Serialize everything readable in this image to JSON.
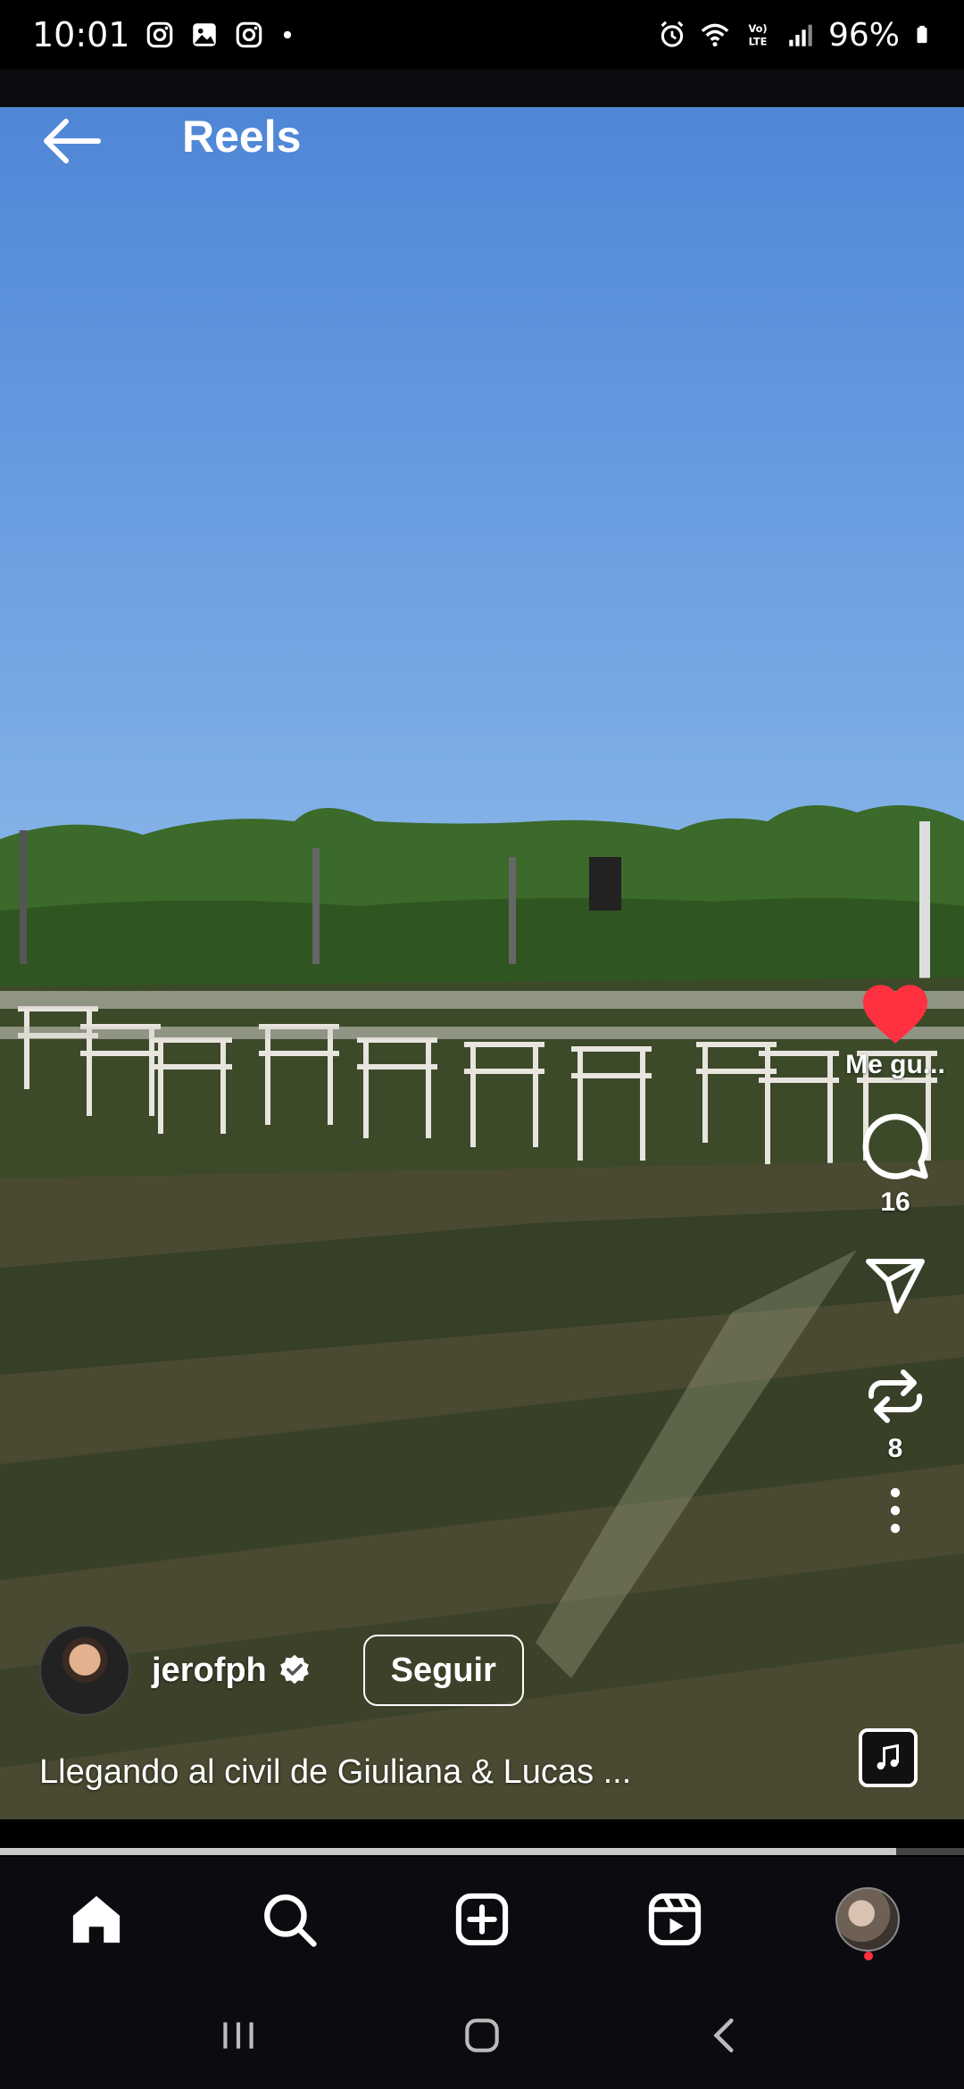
{
  "status_bar": {
    "time": "10:01",
    "battery": "96%",
    "left_icons": [
      "instagram-icon",
      "gallery-icon",
      "instagram-icon",
      "dot-icon"
    ],
    "right_icons": [
      "alarm-icon",
      "wifi-icon",
      "volte-icon",
      "signal-icon",
      "battery-icon"
    ]
  },
  "header": {
    "title": "Reels",
    "back_icon": "arrow-left-icon"
  },
  "actions": {
    "like_label": "Me gu...",
    "like_color": "#ff3040",
    "comment_count": "16",
    "share_icon": "paper-plane-icon",
    "remix_count": "8"
  },
  "author": {
    "username": "jerofph",
    "verified": true,
    "follow_label": "Seguir"
  },
  "caption": "Llegando al civil de Giuliana & Lucas ...",
  "progress": 0.93,
  "bottom_nav": {
    "items": [
      "home-icon",
      "search-icon",
      "create-icon",
      "reels-icon",
      "profile-avatar"
    ]
  },
  "colors": {
    "like": "#ff3040",
    "nav_bg": "#0c0c10"
  }
}
